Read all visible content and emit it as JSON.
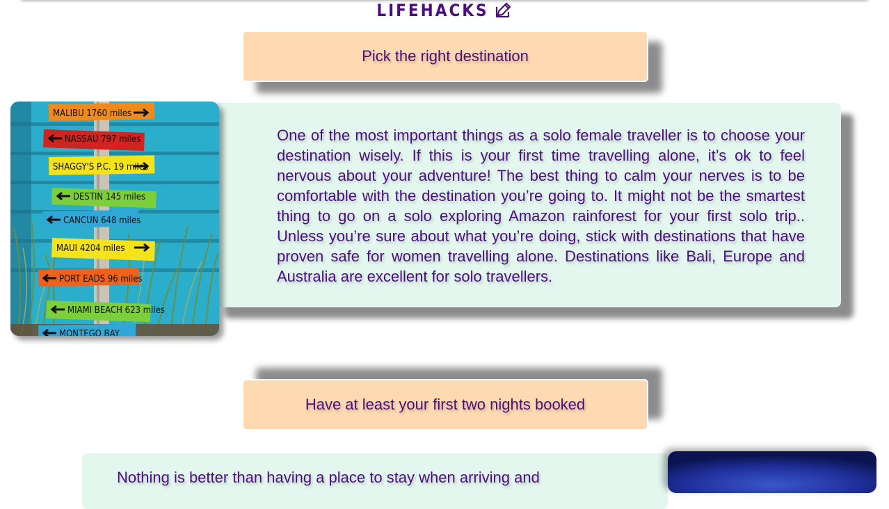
{
  "page_title": "LIFEHACKS",
  "sections": [
    {
      "heading": "Pick the right destination",
      "body": "One of the most important things as a solo female traveller is to choose your destination wisely. If this is your first time travelling alone, it’s ok to feel nervous about your adventure! The best thing to calm your nerves is to be comfortable with the destination you’re going to. It might not be the smartest thing to go on a solo exploring Amazon rainforest for your first solo trip.. Unless you’re sure about what you’re doing, stick with destinations that have proven safe for women travelling alone. Destinations like Bali, Europe and Australia are excellent for solo travellers.",
      "signs": [
        {
          "label": "MALIBU 1760 miles",
          "color": "#f08a1c",
          "dir": "right"
        },
        {
          "label": "NASSAU 797 miles",
          "color": "#d1231f",
          "dir": "left"
        },
        {
          "label": "SHAGGY'S P.C. 19 miles",
          "color": "#f4e21a",
          "dir": "right"
        },
        {
          "label": "DESTIN 145 miles",
          "color": "#7ccf3a",
          "dir": "left"
        },
        {
          "label": "CANCUN 648 miles",
          "color": "#2fa8d8",
          "dir": "left"
        },
        {
          "label": "MAUI 4204 miles",
          "color": "#f4e21a",
          "dir": "right"
        },
        {
          "label": "PORT EADS 96 miles",
          "color": "#f0621c",
          "dir": "left"
        },
        {
          "label": "MIAMI BEACH 623 miles",
          "color": "#7ccf3a",
          "dir": "left"
        },
        {
          "label": "MONTEGO BAY",
          "color": "#2fa8d8",
          "dir": "left"
        }
      ]
    },
    {
      "heading": "Have at least your first two nights booked",
      "body": "Nothing is better than having a place to stay when arriving and"
    }
  ],
  "colors": {
    "accent": "#4b0f7d",
    "pill_bg": "#ffd9b1",
    "card_bg": "#e3f7ef",
    "fence": "#2aaecb"
  },
  "icons": {
    "title_icon": "edit-icon"
  }
}
